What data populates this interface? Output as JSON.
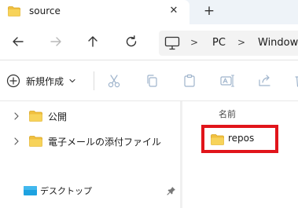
{
  "tab": {
    "title": "source",
    "close_glyph": "✕",
    "new_tab_glyph": "+"
  },
  "nav": {
    "back_icon": "arrow-left-icon",
    "forward_icon": "arrow-right-icon",
    "up_icon": "arrow-up-icon",
    "refresh_icon": "refresh-icon"
  },
  "address": {
    "chevron": ">",
    "crumbs": [
      "PC",
      "Windows"
    ]
  },
  "toolbar": {
    "new_label": "新規作成"
  },
  "sidebar": {
    "items": [
      {
        "label": "公開",
        "icon": "folder-icon"
      },
      {
        "label": "電子メールの添付ファイル",
        "icon": "folder-icon"
      }
    ],
    "desktop_label": "デスクトップ"
  },
  "content": {
    "column_name": "名前",
    "files": [
      {
        "name": "repos",
        "icon": "folder-icon",
        "highlighted": true
      }
    ]
  },
  "colors": {
    "folder": "#f0c040",
    "highlight": "#e1151b",
    "accent": "#0067c0"
  }
}
